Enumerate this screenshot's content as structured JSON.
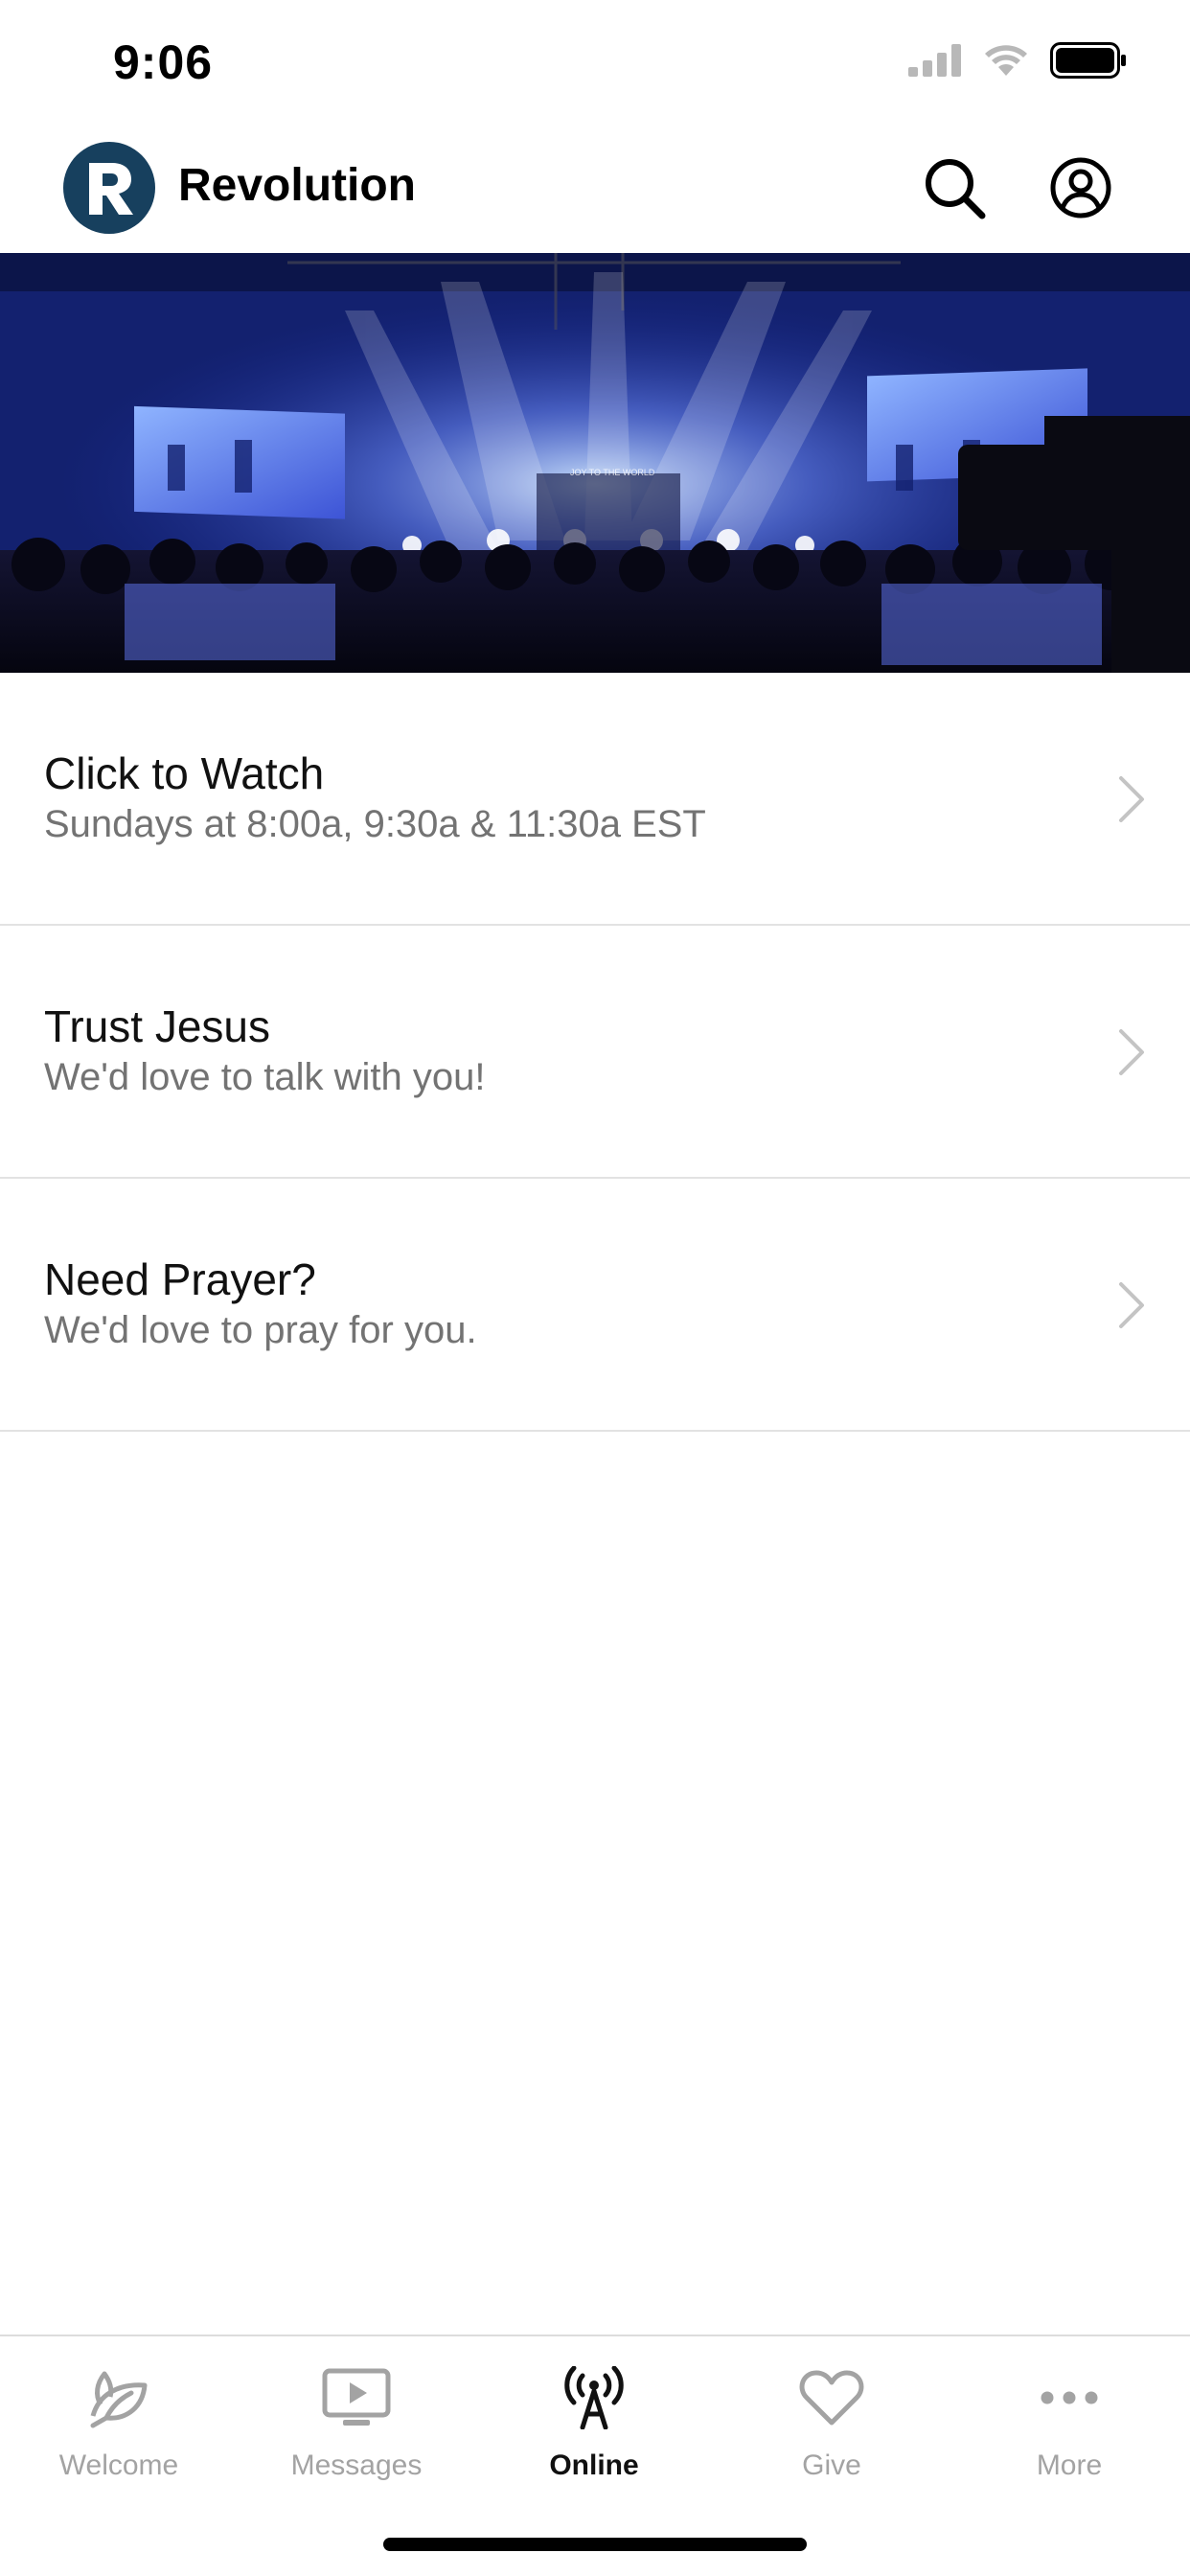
{
  "status_bar": {
    "time": "9:06"
  },
  "header": {
    "app_title": "Revolution",
    "logo_letter": "R"
  },
  "hero": {
    "screen_caption": "JOY TO THE WORLD"
  },
  "list": {
    "items": [
      {
        "title": "Click to Watch",
        "subtitle": "Sundays at 8:00a, 9:30a & 11:30a EST"
      },
      {
        "title": "Trust Jesus",
        "subtitle": "We'd love to talk with you!"
      },
      {
        "title": "Need Prayer?",
        "subtitle": "We'd love to pray for you."
      }
    ]
  },
  "tabs": [
    {
      "label": "Welcome",
      "icon": "leaf-icon",
      "active": false
    },
    {
      "label": "Messages",
      "icon": "tv-play-icon",
      "active": false
    },
    {
      "label": "Online",
      "icon": "broadcast-icon",
      "active": true
    },
    {
      "label": "Give",
      "icon": "heart-icon",
      "active": false
    },
    {
      "label": "More",
      "icon": "ellipsis-icon",
      "active": false
    }
  ],
  "colors": {
    "brand": "#17405e",
    "inactive_tab": "#a3a3a3",
    "subtitle_gray": "#737373",
    "divider": "#e2e2e2"
  }
}
